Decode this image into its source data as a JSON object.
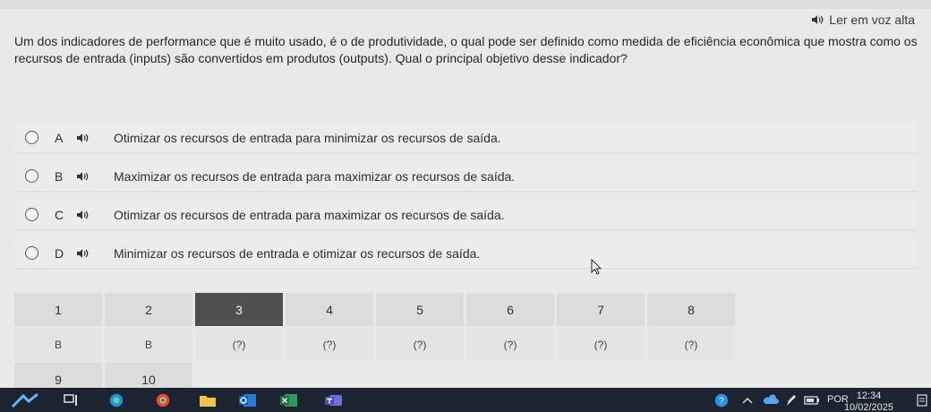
{
  "listen": {
    "label": "Ler em voz alta"
  },
  "question": {
    "text": "Um dos indicadores de performance que é muito usado, é o de produtividade, o qual pode ser definido como medida de eficiência econômica que mostra como os recursos de entrada (inputs) são convertidos em produtos (outputs). Qual o principal objetivo desse indicador?"
  },
  "options": [
    {
      "letter": "A",
      "text": "Otimizar os recursos de entrada para minimizar os recursos de saída."
    },
    {
      "letter": "B",
      "text": "Maximizar os recursos de entrada para maximizar os recursos de saída."
    },
    {
      "letter": "C",
      "text": "Otimizar os recursos de entrada para maximizar os recursos de saída."
    },
    {
      "letter": "D",
      "text": "Minimizar os recursos de entrada e otimizar os recursos de saída."
    }
  ],
  "nav": {
    "numbers": [
      "1",
      "2",
      "3",
      "4",
      "5",
      "6",
      "7",
      "8"
    ],
    "answers": [
      "B",
      "B",
      "(?)",
      "(?)",
      "(?)",
      "(?)",
      "(?)",
      "(?)"
    ],
    "numbers2": [
      "9",
      "10"
    ],
    "active_index": 2
  },
  "taskbar": {
    "language": "POR",
    "time": "12:34",
    "date": "10/02/2025"
  },
  "colors": {
    "background": "#e9e9e7",
    "active_cell": "#4f4f4f",
    "taskbar": "#1c2431"
  }
}
